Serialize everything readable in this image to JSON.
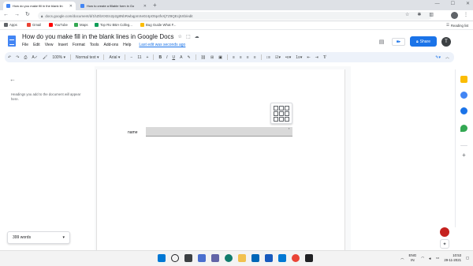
{
  "browser": {
    "tabs": [
      {
        "title": "How do you make fill in the blank lin",
        "active": true,
        "favicon_color": "#4285f4"
      },
      {
        "title": "How to create a fillable form in Go",
        "active": false,
        "favicon_color": "#4285f4"
      }
    ],
    "url": "docs.google.com/document/d/1hZIbXXEn2p2g8NbRwbqpmXe0z4pO5p4fvXjTZ8QEcj5Xb/edit",
    "bookmarks": [
      {
        "label": "Apps",
        "color": "#5f6368"
      },
      {
        "label": "Gmail",
        "color": "#ea4335"
      },
      {
        "label": "YouTube",
        "color": "#ff0000"
      },
      {
        "label": "Maps",
        "color": "#34a853"
      },
      {
        "label": "Top RU BBA Colleg...",
        "color": "#0f9d58"
      },
      {
        "label": "Bug Guide What F...",
        "color": "#fbbc04"
      }
    ],
    "reading_list": "Reading list"
  },
  "doc": {
    "title": "How do you make fill in the blank lines in Google Docs",
    "menu": [
      "File",
      "Edit",
      "View",
      "Insert",
      "Format",
      "Tools",
      "Add-ons",
      "Help"
    ],
    "last_edit": "Last edit was seconds ago",
    "share_label": "Share",
    "user_initial": "T"
  },
  "toolbar": {
    "zoom": "100%",
    "style": "Normal text",
    "font": "Arial",
    "size": "11"
  },
  "outline": {
    "note": "Headings you add to the document will appear here."
  },
  "document_body": {
    "label": "name"
  },
  "status": {
    "word_count": "399 words"
  },
  "taskbar": {
    "lang": "ENG",
    "lang_sub": "IN",
    "time": "10:53",
    "date": "29-11-2021"
  },
  "colors": {
    "accent": "#1a73e8",
    "docs_blue": "#4285f4",
    "field_gray": "#d9d9d9"
  }
}
